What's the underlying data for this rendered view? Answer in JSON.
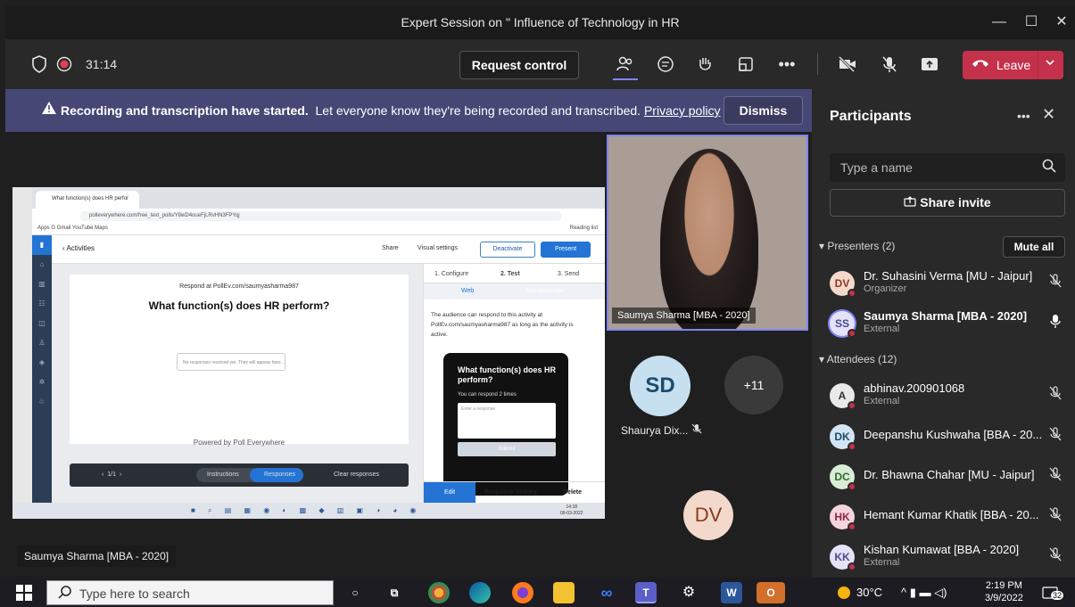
{
  "window": {
    "title": "Expert Session on \" Influence of Technology in HR",
    "minimize": "—",
    "maximize": "☐",
    "close": "✕"
  },
  "toolbar": {
    "timer": "31:14",
    "request_control": "Request control",
    "leave": "Leave"
  },
  "banner": {
    "bold": "Recording and transcription have started.",
    "text": "Let everyone know they're being recorded and transcribed.",
    "link": "Privacy policy",
    "dismiss": "Dismiss"
  },
  "share": {
    "tab_title": "What function(s) does HR perfor",
    "url": "pollev​erywhere.com/free_text_polls/Y8wD4oueFjLRvHN3FPYqj",
    "bookmarks": "Apps   G Gmail   YouTube   Maps",
    "reading_list": "Reading list",
    "activities": "Activities",
    "share": "Share",
    "visual_settings": "Visual settings",
    "deactivate": "Deactivate",
    "present": "Present",
    "respond_at": "Respond at PollEv.com/saumyasharma987",
    "question": "What function(s) does HR perform?",
    "no_responses": "No responses received yet. They will appear here...",
    "powered_by": "Powered by  Poll Everywhere",
    "page": "1/1",
    "instructions": "Instructions",
    "responses": "Responses",
    "clear": "Clear responses",
    "step1": "1. Configure",
    "step2": "2. Test",
    "step3": "3. Send",
    "web": "Web",
    "text_message": "Text message",
    "help": "The audience can respond to this activity at PollEv.com/saumyasharma987 as long as the activity is active.",
    "phone_q": "What function(s) does HR perform?",
    "phone_times": "You can respond 2 times",
    "phone_placeholder": "Enter a response",
    "phone_submit": "Submit",
    "edit": "Edit",
    "response_history": "Response history",
    "delete": "Delete",
    "mini_clock": "14:18\n09-03-2022"
  },
  "stage": {
    "presenter_label": "Saumya Sharma [MBA - 2020]",
    "video_label": "Saumya Sharma [MBA - 2020]",
    "sd_initials": "SD",
    "sd_name": "Shaurya Dix...",
    "more_count": "+11",
    "dv_initials": "DV"
  },
  "panel": {
    "title": "Participants",
    "search_placeholder": "Type a name",
    "share_invite": "Share invite",
    "presenters_header": "Presenters (2)",
    "mute_all": "Mute all",
    "attendees_header": "Attendees (12)",
    "presenters": [
      {
        "initials": "DV",
        "name": "Dr. Suhasini Verma [MU - Jaipur]",
        "role": "Organizer",
        "color": "#f3d9cc"
      },
      {
        "initials": "SS",
        "name": "Saumya Sharma [MBA - 2020]",
        "role": "External",
        "color": "#e6e2f7"
      }
    ],
    "attendees": [
      {
        "initials": "A",
        "name": "abhinav.200901068",
        "role": "External",
        "color": "#e9e9e9"
      },
      {
        "initials": "DK",
        "name": "Deepanshu Kushwaha [BBA - 20...",
        "role": "",
        "color": "#d3e4f4"
      },
      {
        "initials": "DC",
        "name": "Dr. Bhawna Chahar [MU - Jaipur]",
        "role": "",
        "color": "#d8ecd6"
      },
      {
        "initials": "HK",
        "name": "Hemant Kumar Khatik [BBA - 20...",
        "role": "",
        "color": "#f6d4dc"
      },
      {
        "initials": "KK",
        "name": "Kishan Kumawat [BBA - 2020]",
        "role": "External",
        "color": "#e6e2f7"
      }
    ]
  },
  "taskbar": {
    "search": "Type here to search",
    "temp": "30°C",
    "time": "2:19 PM",
    "date": "3/9/2022",
    "notifications": "32"
  }
}
